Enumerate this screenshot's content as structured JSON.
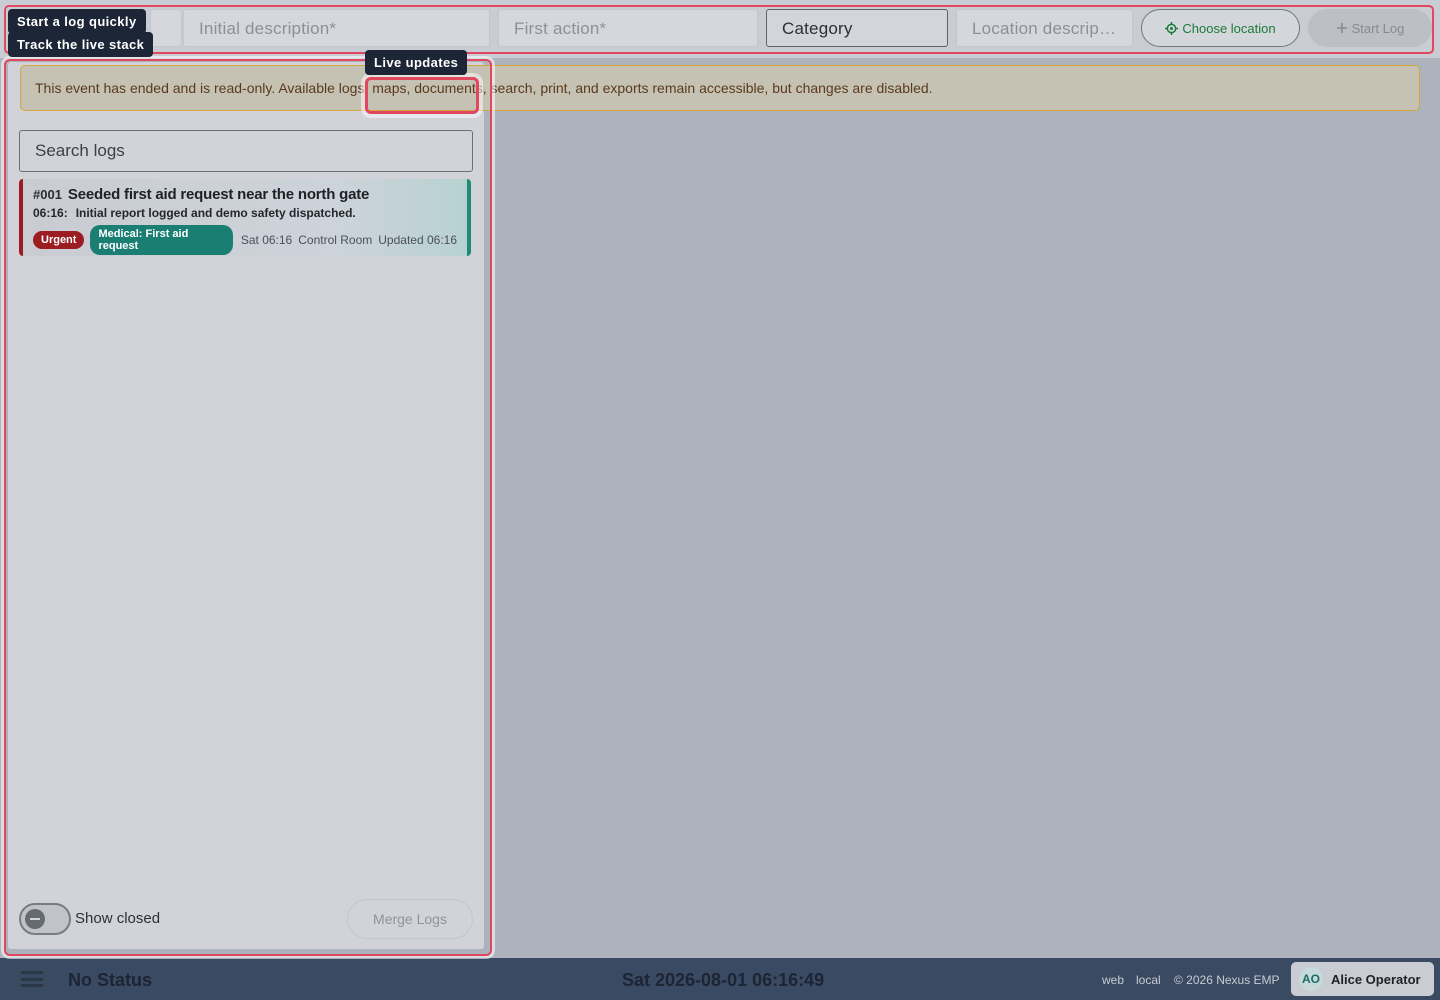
{
  "topbar": {
    "fields": {
      "initial_description": "Initial description*",
      "first_action": "First action*",
      "category": "Category",
      "location_description": "Location descripti..."
    },
    "choose_location_label": "Choose location",
    "start_log_label": "Start Log"
  },
  "tooltips": {
    "start_log": "Start a log quickly",
    "live_stack": "Track the live stack",
    "live_updates": "Live updates"
  },
  "banner": {
    "text": "This event has ended and is read-only. Available logs, maps, documents, search, print, and exports remain accessible, but changes are disabled."
  },
  "log_panel": {
    "search_placeholder": "Search logs",
    "logs": [
      {
        "number": "#001",
        "title": "Seeded first aid request near the north gate",
        "time": "06:16:",
        "summary": "Initial report logged and demo safety dispatched.",
        "priority": "Urgent",
        "category": "Medical: First aid request",
        "date": "Sat 06:16",
        "location": "Control Room",
        "updated": "Updated 06:16"
      }
    ],
    "show_closed_label": "Show closed",
    "show_closed": false,
    "merge_label": "Merge Logs"
  },
  "footer": {
    "status": "No Status",
    "datetime": "Sat 2026-08-01 06:16:49",
    "platform": "web",
    "env": "local",
    "copyright": "© 2026 Nexus EMP",
    "user_initials": "AO",
    "user_name": "Alice Operator"
  },
  "colors": {
    "highlight": "#e0485f",
    "urgent": "#9b1d22",
    "category": "#1a7f72",
    "footer_bg": "#3a4a63"
  }
}
